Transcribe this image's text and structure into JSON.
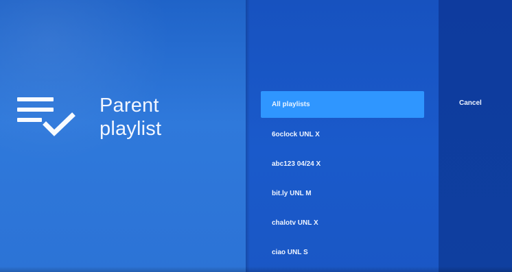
{
  "page": {
    "title_line_1": "Parent",
    "title_line_2": "playlist"
  },
  "icons": {
    "playlist": "playlist-check-icon"
  },
  "list": {
    "items": [
      {
        "label": "All playlists",
        "selected": true
      },
      {
        "label": "6oclock UNL X",
        "selected": false
      },
      {
        "label": "abc123 04/24 X",
        "selected": false
      },
      {
        "label": "bit.ly UNL M",
        "selected": false
      },
      {
        "label": "chalotv UNL X",
        "selected": false
      },
      {
        "label": "ciao UNL S",
        "selected": false
      }
    ]
  },
  "actions": {
    "cancel_label": "Cancel"
  },
  "colors": {
    "left_panel": "#2c73d6",
    "middle_panel": "#1a57c5",
    "right_panel": "#0f3f9f",
    "selected_item": "#2f96ff",
    "text": "#eef4ff"
  }
}
